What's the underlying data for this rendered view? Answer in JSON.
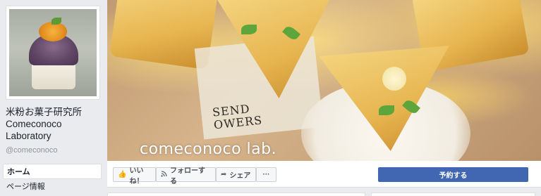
{
  "page": {
    "name_line1": "米粉お菓子研究所",
    "name_line2": "Comeconoco",
    "name_line3": "Laboratory",
    "handle": "@comeconoco"
  },
  "nav": {
    "items": [
      {
        "label": "ホーム",
        "active": true
      },
      {
        "label": "ページ情報",
        "active": false
      }
    ]
  },
  "cover": {
    "watermark": "comeconoco lab.",
    "paper_text_line1": "SEND",
    "paper_text_line2": "OWERS"
  },
  "actions": {
    "like_label": "いいね！",
    "follow_label": "フォローする",
    "share_label": "シェア",
    "more_label": "···",
    "reserve_label": "予約する"
  },
  "icons": {
    "like": "thumbs-up-icon",
    "follow": "rss-icon",
    "share": "share-arrow-icon"
  },
  "colors": {
    "background": "#e9ebee",
    "primary_button": "#4267b2",
    "secondary_text": "#90949c"
  }
}
